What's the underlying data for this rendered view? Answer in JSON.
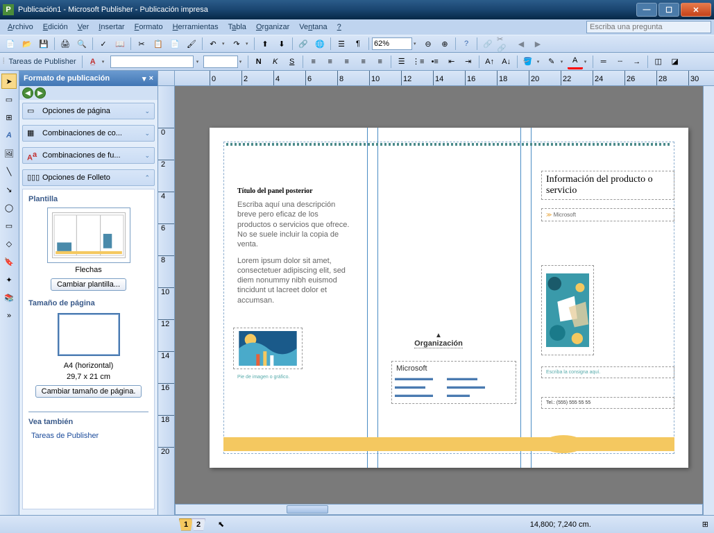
{
  "title": "Publicación1 - Microsoft Publisher - Publicación impresa",
  "menu": [
    "Archivo",
    "Edición",
    "Ver",
    "Insertar",
    "Formato",
    "Herramientas",
    "Tabla",
    "Organizar",
    "Ventana",
    "?"
  ],
  "help_placeholder": "Escriba una pregunta",
  "zoom": "62%",
  "tasks_label": "Tareas de Publisher",
  "task_pane": {
    "title": "Formato de publicación",
    "sections": {
      "page_opts": "Opciones de página",
      "color": "Combinaciones de co...",
      "font": "Combinaciones de fu...",
      "brochure": "Opciones de Folleto"
    },
    "template_title": "Plantilla",
    "template_name": "Flechas",
    "change_template": "Cambiar plantilla...",
    "page_size_title": "Tamaño de página",
    "page_size_name": "A4 (horizontal)",
    "page_size_dims": "29,7 x 21 cm",
    "change_size": "Cambiar tamaño de página.",
    "see_also": "Vea también",
    "see_also_link": "Tareas de Publisher"
  },
  "doc": {
    "panel1": {
      "title": "Título del panel posterior",
      "p1": "Escriba aquí una descripción breve pero eficaz de los productos o servicios que ofrece. No se suele incluir la copia de venta.",
      "p2": "Lorem ipsum dolor sit amet, consectetuer adipiscing elit, sed diem nonummy nibh euismod tincidunt ut lacreet dolor et accumsan.",
      "caption": "Pie de imagen o gráfico."
    },
    "panel2": {
      "org": "Organización",
      "company": "Microsoft"
    },
    "panel3": {
      "title": "Información del producto o servicio",
      "sub": "Microsoft",
      "slogan": "Escriba la consigna aquí.",
      "tel": "Tel.: (555) 555 55 55"
    }
  },
  "pages": [
    "1",
    "2"
  ],
  "status_coord": "14,800; 7,240 cm.",
  "ruler_h": [
    "0",
    "2",
    "4",
    "6",
    "8",
    "10",
    "12",
    "14",
    "16",
    "18",
    "20",
    "22",
    "24",
    "26",
    "28",
    "30"
  ],
  "ruler_v": [
    "0",
    "2",
    "4",
    "6",
    "8",
    "10",
    "12",
    "14",
    "16",
    "18",
    "20"
  ]
}
